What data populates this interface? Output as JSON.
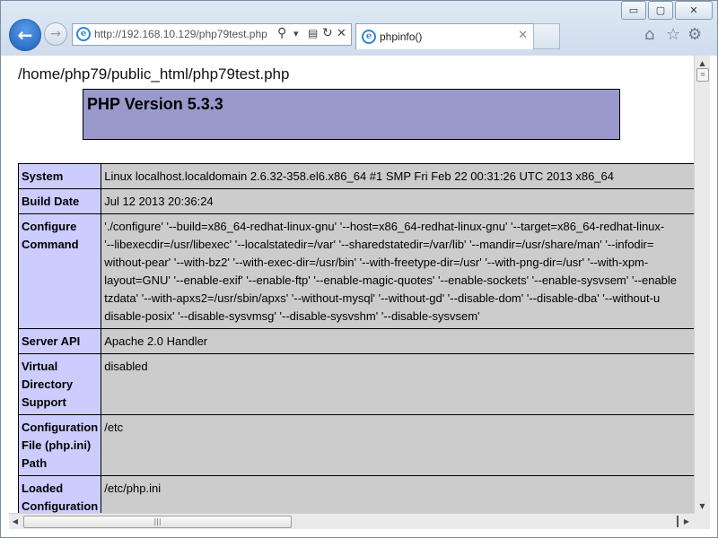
{
  "window": {
    "minimize_glyph": "▭",
    "maximize_glyph": "▢",
    "close_glyph": "✕"
  },
  "nav": {
    "back_glyph": "←",
    "forward_glyph": "→"
  },
  "address_bar": {
    "url": "http://192.168.10.129/php79test.php",
    "search_glyph": "⚲",
    "dropdown_glyph": "▾",
    "compat_glyph": "▤",
    "refresh_glyph": "↻",
    "stop_glyph": "✕",
    "icon": "ie-icon"
  },
  "tab": {
    "title": "phpinfo()",
    "close_glyph": "✕",
    "icon": "ie-icon"
  },
  "toolbar": {
    "home_glyph": "⌂",
    "favorites_glyph": "☆",
    "tools_glyph": "⚙"
  },
  "page": {
    "path": "/home/php79/public_html/php79test.php",
    "php_version": "PHP Version 5.3.3",
    "rows": [
      {
        "label": "System",
        "value": "Linux localhost.localdomain 2.6.32-358.el6.x86_64 #1 SMP Fri Feb 22 00:31:26 UTC 2013 x86_64"
      },
      {
        "label": "Build Date",
        "value": "Jul 12 2013 20:36:24"
      },
      {
        "label": "Configure Command",
        "lines": [
          "'./configure' '--build=x86_64-redhat-linux-gnu' '--host=x86_64-redhat-linux-gnu' '--target=x86_64-redhat-linux-",
          "'--libexecdir=/usr/libexec' '--localstatedir=/var' '--sharedstatedir=/var/lib' '--mandir=/usr/share/man' '--infodir=",
          "without-pear' '--with-bz2' '--with-exec-dir=/usr/bin' '--with-freetype-dir=/usr' '--with-png-dir=/usr' '--with-xpm-",
          "layout=GNU' '--enable-exif' '--enable-ftp' '--enable-magic-quotes' '--enable-sockets' '--enable-sysvsem' '--enable",
          "tzdata' '--with-apxs2=/usr/sbin/apxs' '--without-mysql' '--without-gd' '--disable-dom' '--disable-dba' '--without-u",
          "disable-posix' '--disable-sysvmsg' '--disable-sysvshm' '--disable-sysvsem'"
        ]
      },
      {
        "label": "Server API",
        "value": "Apache 2.0 Handler"
      },
      {
        "label": "Virtual Directory Support",
        "value": "disabled"
      },
      {
        "label": "Configuration File (php.ini) Path",
        "value": "/etc"
      },
      {
        "label": "Loaded Configuration File",
        "value": "/etc/php.ini"
      }
    ],
    "colors": {
      "header_bg": "#9999cc",
      "label_bg": "#ccccff",
      "value_bg": "#cccccc"
    }
  },
  "scrollbars": {
    "up_glyph": "▲",
    "down_glyph": "▼",
    "left_glyph": "◀",
    "right_glyph": "▶",
    "grip_glyph": "≡",
    "h_grip_glyph": "|||"
  }
}
